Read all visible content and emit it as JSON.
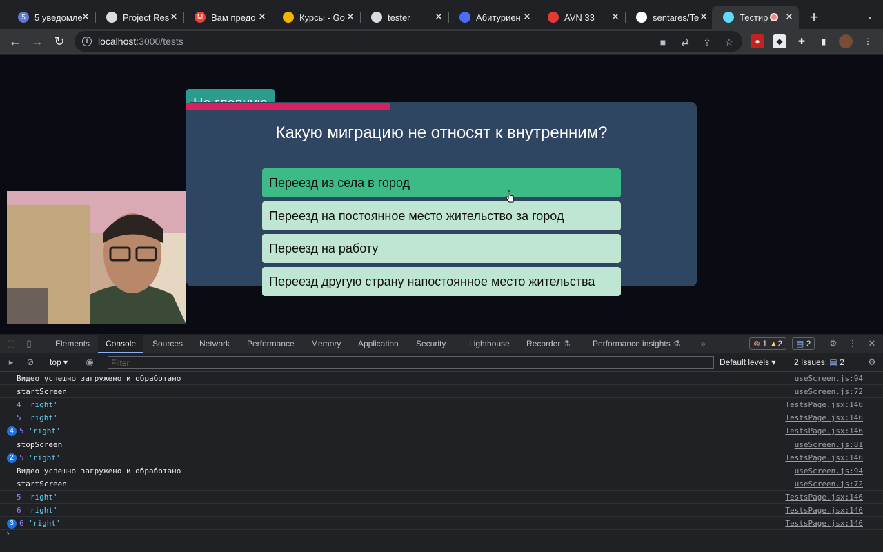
{
  "browser": {
    "tabs": [
      {
        "label": "5 уведомле",
        "favicon": "5",
        "color": "#5b7bd5"
      },
      {
        "label": "Project Res",
        "favicon": "",
        "color": "#dadce0"
      },
      {
        "label": "Вам предо",
        "favicon": "M",
        "color": "#ea4335"
      },
      {
        "label": "Курсы - Go",
        "favicon": "",
        "color": "#f4b400"
      },
      {
        "label": "tester",
        "favicon": "",
        "color": "#dadce0"
      },
      {
        "label": "Абитуриен",
        "favicon": "",
        "color": "#4a6cf7"
      },
      {
        "label": "AVN 33",
        "favicon": "",
        "color": "#e53935"
      },
      {
        "label": "sentares/Te",
        "favicon": "",
        "color": "#ffffff"
      },
      {
        "label": "Тестир",
        "favicon": "",
        "color": "#61dafb"
      }
    ],
    "url_host": "localhost",
    "url_path": ":3000/tests"
  },
  "page": {
    "back_button": "На главную",
    "progress_fraction": 0.4,
    "question": "Какую миграцию не относят к внутренним?",
    "answers": [
      "Переезд из села в город",
      "Переезд на постоянное место жительство за город",
      "Переезд на работу",
      "Переезд другую страну напостоянное место жительства"
    ],
    "selected_answer_index": 0
  },
  "devtools": {
    "tabs": [
      "Elements",
      "Console",
      "Sources",
      "Network",
      "Performance",
      "Memory",
      "Application",
      "Security",
      "Lighthouse",
      "Recorder",
      "Performance insights"
    ],
    "errors": "1",
    "warnings": "2",
    "messages": "2",
    "context": "top",
    "filter_placeholder": "Filter",
    "levels": "Default levels",
    "issues_label": "2 Issues:",
    "issues_count": "2"
  },
  "console_rows": [
    {
      "count": "",
      "num": "",
      "text": "Видео успешно загружено и обработано",
      "src": "useScreen.js:94"
    },
    {
      "count": "",
      "num": "",
      "text": "startScreen",
      "src": "useScreen.js:72"
    },
    {
      "count": "",
      "num": "4",
      "text": "'right'",
      "src": "TestsPage.jsx:146"
    },
    {
      "count": "",
      "num": "5",
      "text": "'right'",
      "src": "TestsPage.jsx:146"
    },
    {
      "count": "4",
      "num": "5",
      "text": "'right'",
      "src": "TestsPage.jsx:146"
    },
    {
      "count": "",
      "num": "",
      "text": "stopScreen",
      "src": "useScreen.js:81"
    },
    {
      "count": "2",
      "num": "5",
      "text": "'right'",
      "src": "TestsPage.jsx:146"
    },
    {
      "count": "",
      "num": "",
      "text": "Видео успешно загружено и обработано",
      "src": "useScreen.js:94"
    },
    {
      "count": "",
      "num": "",
      "text": "startScreen",
      "src": "useScreen.js:72"
    },
    {
      "count": "",
      "num": "5",
      "text": "'right'",
      "src": "TestsPage.jsx:146"
    },
    {
      "count": "",
      "num": "6",
      "text": "'right'",
      "src": "TestsPage.jsx:146"
    },
    {
      "count": "3",
      "num": "6",
      "text": "'right'",
      "src": "TestsPage.jsx:146"
    }
  ]
}
